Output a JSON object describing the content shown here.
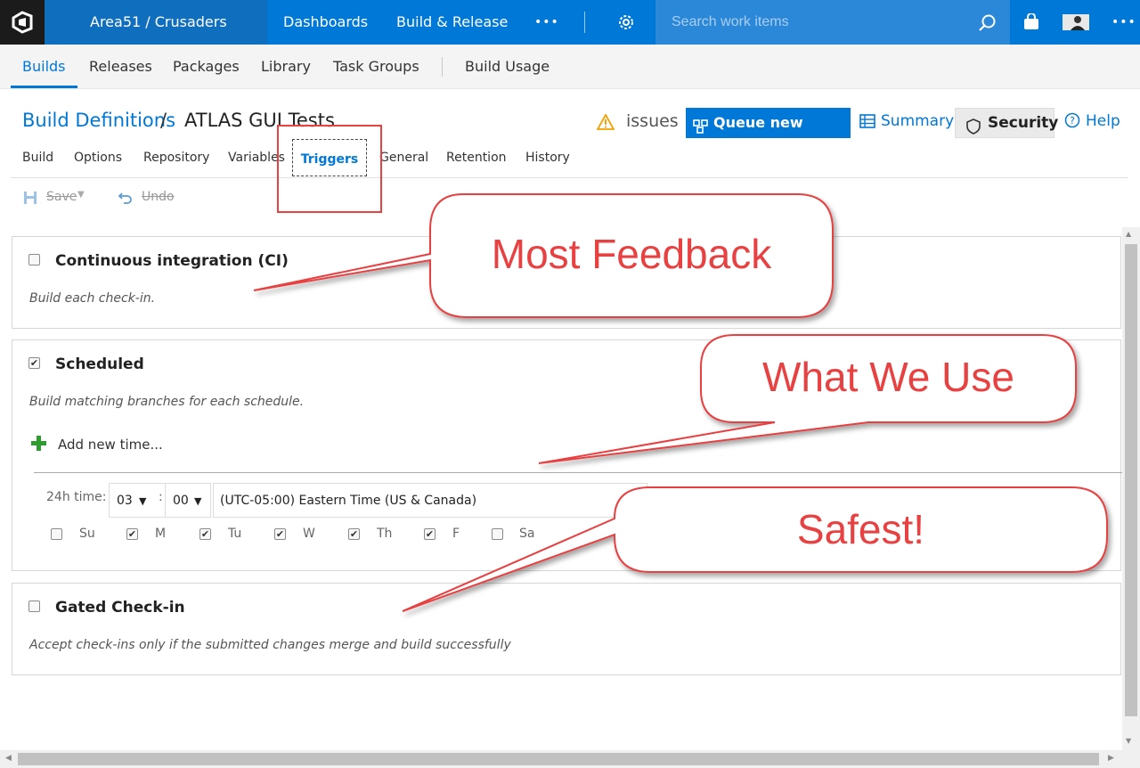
{
  "topbar": {
    "project": "Area51 / Crusaders",
    "nav": [
      "Dashboards",
      "Build & Release"
    ],
    "more": "•••",
    "search_placeholder": "Search work items"
  },
  "hub": {
    "tabs": [
      "Builds",
      "Releases",
      "Packages",
      "Library",
      "Task Groups"
    ],
    "extra": "Build Usage"
  },
  "header": {
    "breadcrumb_link": "Build Definitions",
    "separator": "/",
    "title": "ATLAS GUI Tests",
    "issues": "issues",
    "queue_button": "Queue new build...",
    "summary": "Summary",
    "security": "Security",
    "help": "Help"
  },
  "tabs": [
    "Build",
    "Options",
    "Repository",
    "Variables",
    "Triggers",
    "General",
    "Retention",
    "History"
  ],
  "toolbar": {
    "save": "Save",
    "undo": "Undo"
  },
  "ci": {
    "title": "Continuous integration (CI)",
    "desc": "Build each check-in.",
    "checked": false
  },
  "scheduled": {
    "title": "Scheduled",
    "desc": "Build matching branches for each schedule.",
    "checked": true,
    "add_time": "Add new time...",
    "time_label": "24h time:",
    "hour": "03",
    "colon": ":",
    "minute": "00",
    "timezone": "(UTC-05:00) Eastern Time (US & Canada)",
    "days": [
      {
        "label": "Su",
        "checked": false
      },
      {
        "label": "M",
        "checked": true
      },
      {
        "label": "Tu",
        "checked": true
      },
      {
        "label": "W",
        "checked": true
      },
      {
        "label": "Th",
        "checked": true
      },
      {
        "label": "F",
        "checked": true
      },
      {
        "label": "Sa",
        "checked": false
      }
    ]
  },
  "gated": {
    "title": "Gated Check-in",
    "desc": "Accept check-ins only if the submitted changes merge and build successfully",
    "checked": false
  },
  "callouts": [
    "Most Feedback",
    "What We Use",
    "Safest!"
  ],
  "colors": {
    "accent": "#0078d7",
    "annotation": "#e84141",
    "topbar": "#0078d7",
    "logo_bg": "#1b1b1b"
  }
}
